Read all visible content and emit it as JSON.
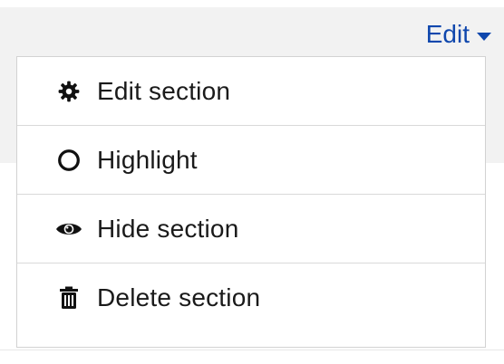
{
  "edit_toggle": {
    "label": "Edit"
  },
  "menu": {
    "items": [
      {
        "label": "Edit section",
        "icon": "gear-icon"
      },
      {
        "label": "Highlight",
        "icon": "circle-outline-icon"
      },
      {
        "label": "Hide section",
        "icon": "eye-icon"
      },
      {
        "label": "Delete section",
        "icon": "trash-icon"
      }
    ]
  },
  "colors": {
    "link": "#0f47ad",
    "text": "#1a1a1a",
    "border": "#d2d2d2"
  }
}
